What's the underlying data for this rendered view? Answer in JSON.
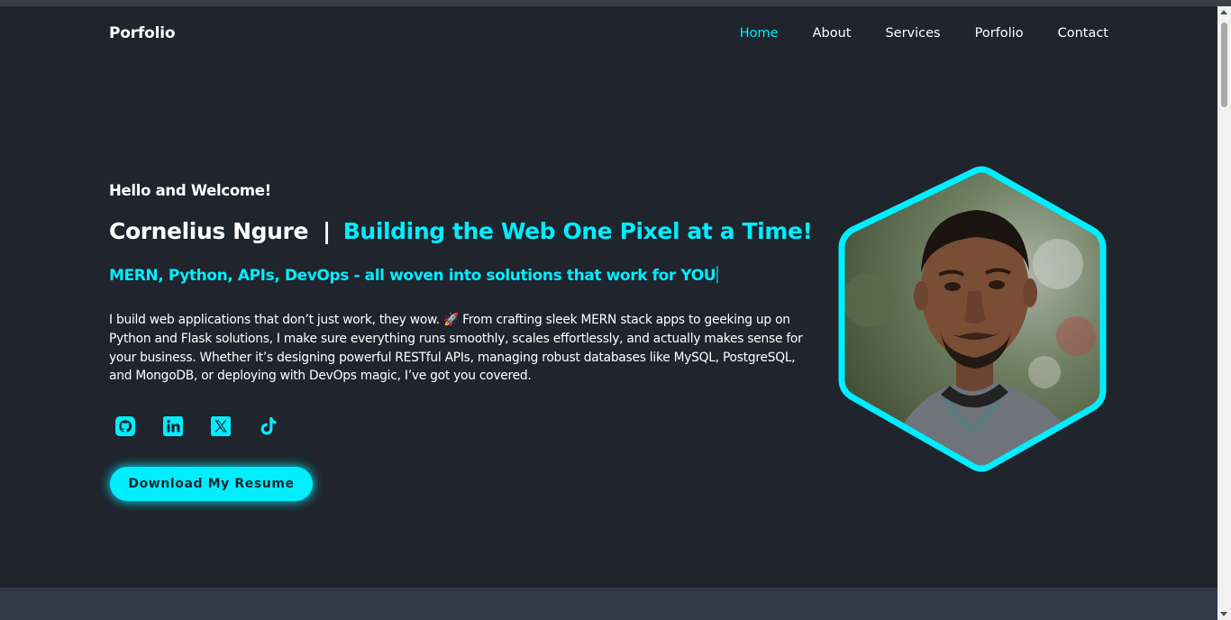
{
  "header": {
    "logo": "Porfolio",
    "nav": [
      {
        "label": "Home",
        "active": true
      },
      {
        "label": "About",
        "active": false
      },
      {
        "label": "Services",
        "active": false
      },
      {
        "label": "Porfolio",
        "active": false
      },
      {
        "label": "Contact",
        "active": false
      }
    ]
  },
  "hero": {
    "greeting": "Hello and Welcome!",
    "name": "Cornelius Ngure",
    "separator": "|",
    "tagline": "Building the Web One Pixel at a Time!",
    "stack": "MERN, Python, APIs, DevOps - all woven into solutions that work for YOU",
    "bio": "I build web applications that don’t just work, they wow. 🚀 From crafting sleek MERN stack apps to geeking up on Python and Flask solutions, I make sure everything runs smoothly, scales effortlessly, and actually makes sense for your business. Whether it’s designing powerful RESTful APIs, managing robust databases like MySQL, PostgreSQL, and MongoDB, or deploying with DevOps magic, I’ve got you covered.",
    "socials": [
      {
        "icon": "github-icon"
      },
      {
        "icon": "linkedin-icon"
      },
      {
        "icon": "x-twitter-icon"
      },
      {
        "icon": "tiktok-icon"
      }
    ],
    "resume_button": "Download My Resume"
  },
  "colors": {
    "accent": "#00eeff",
    "background": "#1f242d",
    "next_section": "#323946"
  }
}
